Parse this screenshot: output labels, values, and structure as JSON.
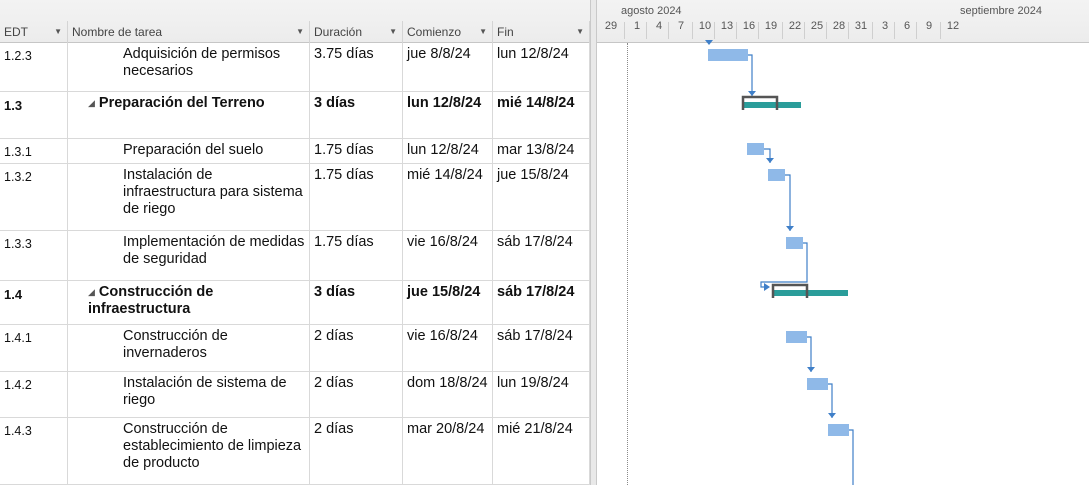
{
  "columns": {
    "edt": "EDT",
    "name": "Nombre de tarea",
    "duration": "Duración",
    "start": "Comienzo",
    "finish": "Fin"
  },
  "tasks": [
    {
      "edt": "1.2.3",
      "name": "Adquisición de permisos necesarios",
      "duration": "3.75 días",
      "start": "jue 8/8/24",
      "finish": "lun 12/8/24",
      "summary": false
    },
    {
      "edt": "1.3",
      "name": "Preparación del Terreno",
      "duration": "3 días",
      "start": "lun 12/8/24",
      "finish": "mié 14/8/24",
      "summary": true
    },
    {
      "edt": "1.3.1",
      "name": "Preparación del suelo",
      "duration": "1.75 días",
      "start": "lun 12/8/24",
      "finish": "mar 13/8/24",
      "summary": false
    },
    {
      "edt": "1.3.2",
      "name": "Instalación de infraestructura para sistema de riego",
      "duration": "1.75 días",
      "start": "mié 14/8/24",
      "finish": "jue 15/8/24",
      "summary": false
    },
    {
      "edt": "1.3.3",
      "name": "Implementación de medidas de seguridad",
      "duration": "1.75 días",
      "start": "vie 16/8/24",
      "finish": "sáb 17/8/24",
      "summary": false
    },
    {
      "edt": "1.4",
      "name": "Construcción de infraestructura",
      "duration": "3 días",
      "start": "jue 15/8/24",
      "finish": "sáb 17/8/24",
      "summary": true
    },
    {
      "edt": "1.4.1",
      "name": "Construcción de invernaderos",
      "duration": "2 días",
      "start": "vie 16/8/24",
      "finish": "sáb 17/8/24",
      "summary": false
    },
    {
      "edt": "1.4.2",
      "name": "Instalación de sistema de riego",
      "duration": "2 días",
      "start": "dom 18/8/24",
      "finish": "lun 19/8/24",
      "summary": false
    },
    {
      "edt": "1.4.3",
      "name": "Construcción de establecimiento de limpieza de producto",
      "duration": "2 días",
      "start": "mar 20/8/24",
      "finish": "mié 21/8/24",
      "summary": false
    }
  ],
  "timescale": {
    "months": [
      "agosto 2024",
      "septiembre 2024"
    ],
    "days": [
      "29",
      "1",
      "4",
      "7",
      "10",
      "13",
      "16",
      "19",
      "22",
      "25",
      "28",
      "31",
      "3",
      "6",
      "9",
      "12"
    ]
  },
  "colors": {
    "task_bar": "#8fb9e8",
    "summary_bar": "#2a9d9a",
    "summary_bracket": "#555555",
    "link": "#3f7fc8"
  }
}
